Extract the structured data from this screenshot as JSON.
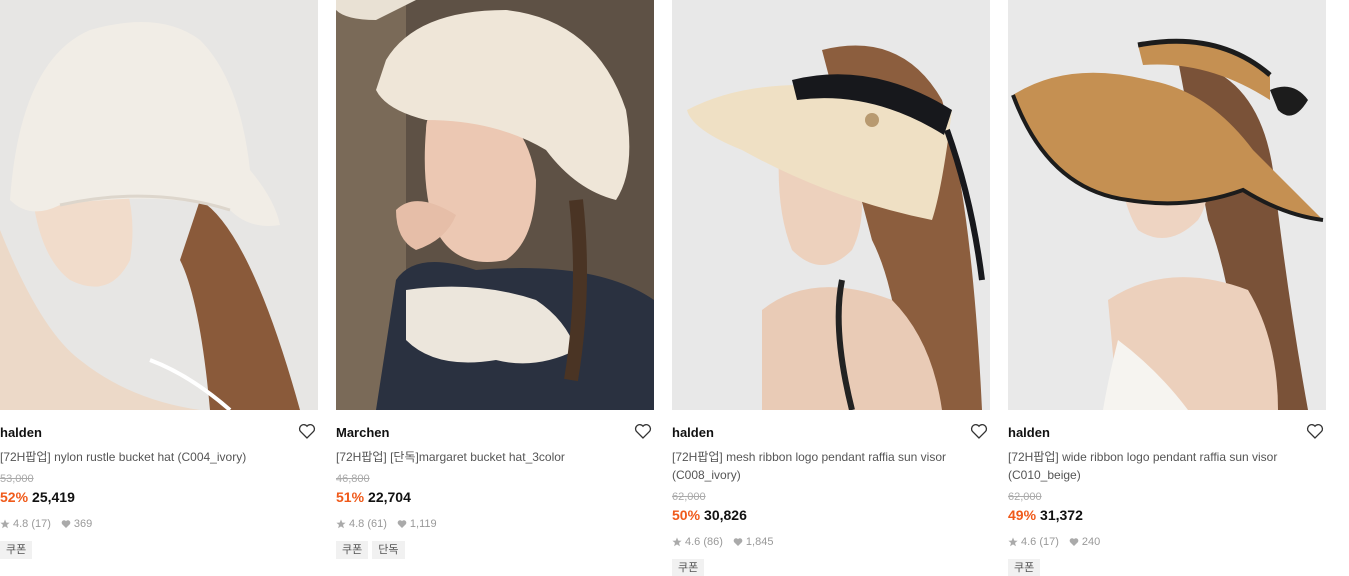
{
  "products": [
    {
      "brand": "halden",
      "name": "[72H팝업] nylon rustle bucket hat (C004_ivory)",
      "original_price": "53,000",
      "discount": "52%",
      "price": "25,419",
      "rating": "4.8",
      "reviews": "(17)",
      "likes": "369",
      "tags": [
        "쿠폰"
      ]
    },
    {
      "brand": "Marchen",
      "name": "[72H팝업] [단독]margaret bucket hat_3color",
      "original_price": "46,800",
      "discount": "51%",
      "price": "22,704",
      "rating": "4.8",
      "reviews": "(61)",
      "likes": "1,119",
      "tags": [
        "쿠폰",
        "단독"
      ]
    },
    {
      "brand": "halden",
      "name": "[72H팝업] mesh ribbon logo pendant raffia sun visor (C008_ivory)",
      "original_price": "62,000",
      "discount": "50%",
      "price": "30,826",
      "rating": "4.6",
      "reviews": "(86)",
      "likes": "1,845",
      "tags": [
        "쿠폰"
      ]
    },
    {
      "brand": "halden",
      "name": "[72H팝업] wide ribbon logo pendant raffia sun visor (C010_beige)",
      "original_price": "62,000",
      "discount": "49%",
      "price": "31,372",
      "rating": "4.6",
      "reviews": "(17)",
      "likes": "240",
      "tags": [
        "쿠폰"
      ]
    }
  ],
  "colors": {
    "discount": "#f05a1a",
    "brand_text": "#111111",
    "muted": "#999999"
  },
  "icons": {
    "wishlist": "heart-outline-icon",
    "rating": "star-icon",
    "likes": "heart-filled-icon"
  }
}
